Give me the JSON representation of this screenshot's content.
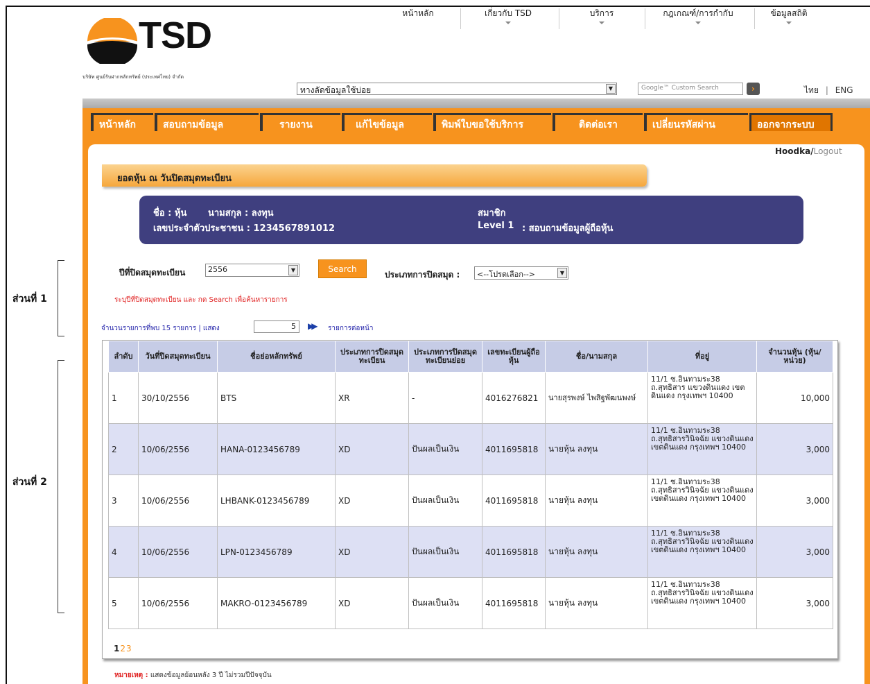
{
  "side_labels": [
    "ส่วนที่ 1",
    "ส่วนที่ 2"
  ],
  "company": {
    "logo_text": "TSD",
    "full_name": "บริษัท ศูนย์รับฝากหลักทรัพย์ (ประเทศไทย) จำกัด"
  },
  "top_nav": [
    "หน้าหลัก",
    "เกี่ยวกับ TSD",
    "บริการ",
    "กฎเกณฑ์/การกำกับ",
    "ข้อมูลสถิติ"
  ],
  "quick_links": {
    "value": "ทางลัดข้อมูลใช้บ่อย"
  },
  "google_search": {
    "placeholder": "Google™ Custom Search"
  },
  "lang": {
    "th": "ไทย",
    "sep": "|",
    "en": "ENG"
  },
  "main_nav": [
    "หน้าหลัก",
    "สอบถามข้อมูล",
    "รายงาน",
    "แก้ไขข้อมูล",
    "พิมพ์ใบขอใช้บริการ",
    "ติดต่อเรา",
    "เปลี่ยนรหัสผ่าน",
    "ออกจากระบบ"
  ],
  "user": {
    "name": "Hoodka",
    "slash": "/",
    "logout": "Logout"
  },
  "section_title": "ยอดหุ้น ณ วันปิดสมุดทะเบียน",
  "info": {
    "name": "ชื่อ : หุ้น",
    "surname": "นามสกุล : ลงทุน",
    "id": "เลขประจำตัวประชาชน : 1234567891012",
    "member": "สมาชิก",
    "level": "Level 1",
    "level_desc": ":  สอบถามข้อมูลผู้ถือหุ้น"
  },
  "filter": {
    "year_label": "ปีที่ปิดสมุดทะเบียน",
    "year_value": "2556",
    "search_label": "Search",
    "type_label": "ประเภทการปิดสมุด :",
    "type_value": "<--โปรดเลือก-->",
    "hint": "ระบุปีที่ปิดสมุดทะเบียน และ กด Search เพื่อค้นหารายการ"
  },
  "count": {
    "text": "จำนวนรายการที่พบ 15 รายการ | แสดง",
    "per_page": "5",
    "next_label": "รายการต่อหน้า"
  },
  "table": {
    "headers": [
      "ลำดับ",
      "วันที่ปิดสมุดทะเบียน",
      "ชื่อย่อหลักทรัพย์",
      "ประเภทการปิดสมุดทะเบียน",
      "ประเภทการปิดสมุดทะเบียนย่อย",
      "เลขทะเบียนผู้ถือหุ้น",
      "ชื่อ/นามสกุล",
      "ที่อยู่",
      "จำนวนหุ้น (หุ้น/หน่วย)"
    ],
    "rows": [
      [
        "1",
        "30/10/2556",
        "BTS",
        "XR",
        "-",
        "4016276821",
        "นายสุรพงษ์ ไพสิฐพัฒนพงษ์",
        "11/1 ซ.อินทามระ38 ถ.สุทธิสาร แขวงดินแดง เขตดินแดง กรุงเทพฯ 10400",
        "10,000"
      ],
      [
        "2",
        "10/06/2556",
        "HANA-0123456789",
        "XD",
        "ปันผลเป็นเงิน",
        "4011695818",
        "นายหุ้น ลงทุน",
        "11/1 ซ.อินทามระ38 ถ.สุทธิสารวินิจฉัย แขวงดินแดง เขตดินแดง กรุงเทพฯ 10400",
        "3,000"
      ],
      [
        "3",
        "10/06/2556",
        "LHBANK-0123456789",
        "XD",
        "ปันผลเป็นเงิน",
        "4011695818",
        "นายหุ้น ลงทุน",
        "11/1 ซ.อินทามระ38 ถ.สุทธิสารวินิจฉัย แขวงดินแดง เขตดินแดง กรุงเทพฯ 10400",
        "3,000"
      ],
      [
        "4",
        "10/06/2556",
        "LPN-0123456789",
        "XD",
        "ปันผลเป็นเงิน",
        "4011695818",
        "นายหุ้น ลงทุน",
        "11/1 ซ.อินทามระ38 ถ.สุทธิสารวินิจฉัย แขวงดินแดง เขตดินแดง กรุงเทพฯ 10400",
        "3,000"
      ],
      [
        "5",
        "10/06/2556",
        "MAKRO-0123456789",
        "XD",
        "ปันผลเป็นเงิน",
        "4011695818",
        "นายหุ้น ลงทุน",
        "11/1 ซ.อินทามระ38 ถ.สุทธิสารวินิจฉัย แขวงดินแดง เขตดินแดง กรุงเทพฯ 10400",
        "3,000"
      ]
    ]
  },
  "pager": {
    "current": "1",
    "pages": [
      "2",
      "3"
    ]
  },
  "note": {
    "label": "หมายเหตุ :",
    "text": "แสดงข้อมูลย้อนหลัง 3 ปี ไม่รวมปีปัจจุบัน"
  },
  "colors": {
    "accent": "#f7931e",
    "info_bg": "#3f3f7f",
    "table_header": "#c6cce6",
    "row_alt": "#dde0f4"
  }
}
